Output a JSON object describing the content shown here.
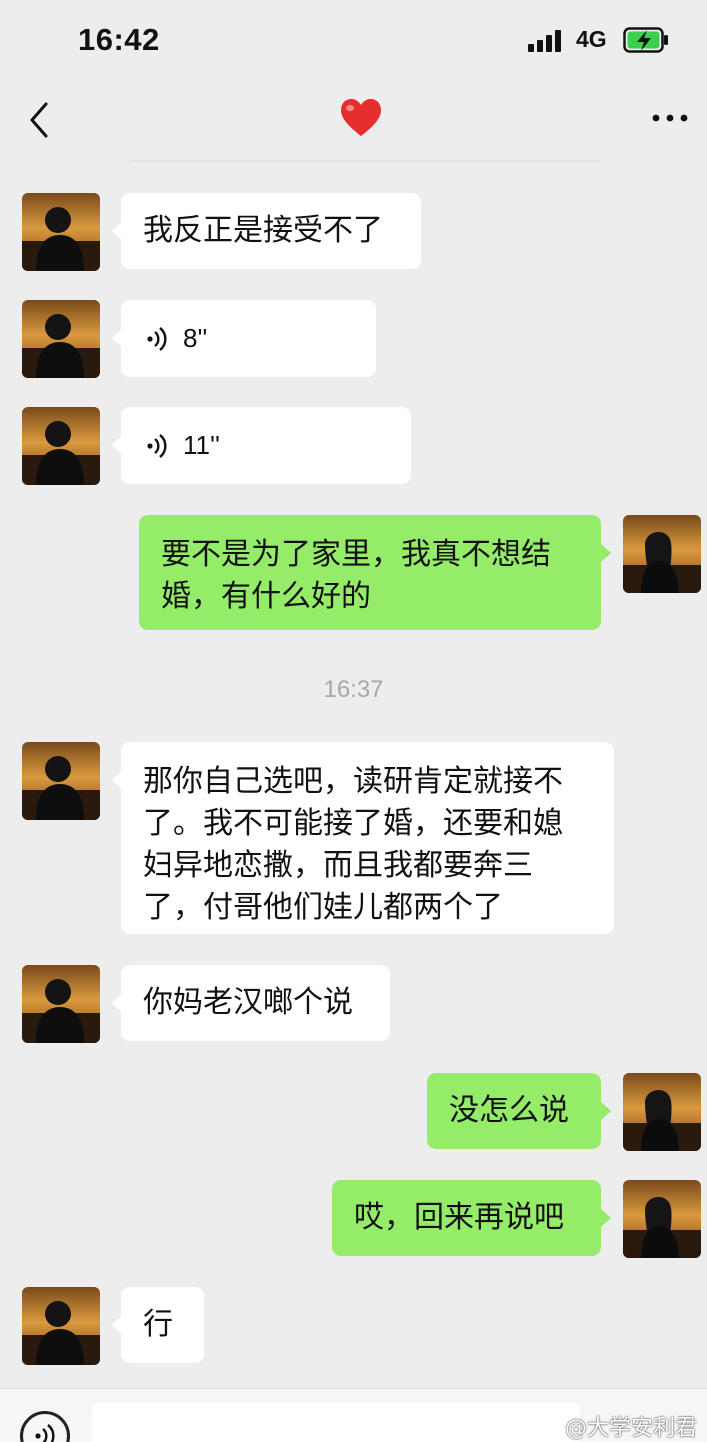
{
  "status_bar": {
    "time": "16:42",
    "network": "4G"
  },
  "header": {
    "title_icon": "heart-icon",
    "back_icon": "back-arrow-icon",
    "more_icon": "more-icon"
  },
  "messages": [
    {
      "from": "them",
      "type": "text",
      "text": "我反正是接受不了"
    },
    {
      "from": "them",
      "type": "voice",
      "duration": "8''"
    },
    {
      "from": "them",
      "type": "voice",
      "duration": "11''"
    },
    {
      "from": "me",
      "type": "text",
      "text": "要不是为了家里，我真不想结\n婚，有什么好的"
    },
    {
      "type": "timestamp",
      "text": "16:37"
    },
    {
      "from": "them",
      "type": "text",
      "text": "那你自己选吧，读研肯定就接不\n了。我不可能接了婚，还要和媳\n妇异地恋撒，而且我都要奔三\n了，付哥他们娃儿都两个了"
    },
    {
      "from": "them",
      "type": "text",
      "text": "你妈老汉啷个说"
    },
    {
      "from": "me",
      "type": "text",
      "text": "没怎么说"
    },
    {
      "from": "me",
      "type": "text",
      "text": "哎，回来再说吧"
    },
    {
      "from": "them",
      "type": "text",
      "text": "行"
    }
  ],
  "watermark": "@大学安利君",
  "colors": {
    "background": "#ededed",
    "incoming_bubble": "#ffffff",
    "outgoing_bubble": "#95ec69",
    "timestamp": "#a8a8a8"
  }
}
